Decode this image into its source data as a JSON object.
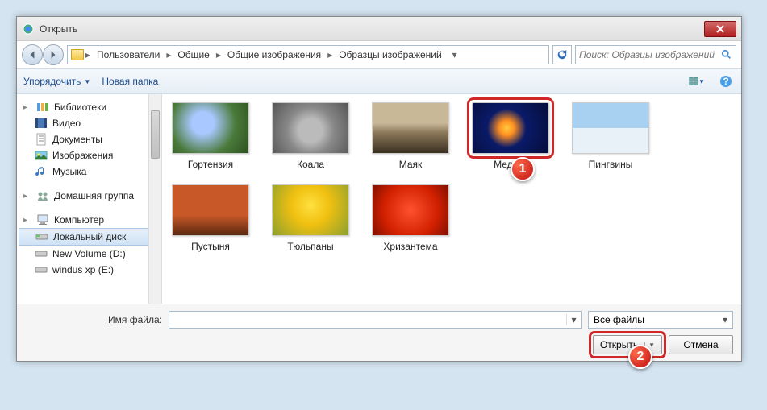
{
  "title": "Открыть",
  "breadcrumb": [
    "Пользователи",
    "Общие",
    "Общие изображения",
    "Образцы изображений"
  ],
  "search_placeholder": "Поиск: Образцы изображений",
  "toolbar": {
    "organize": "Упорядочить",
    "newfolder": "Новая папка"
  },
  "sidebar": {
    "libraries": {
      "label": "Библиотеки",
      "items": [
        "Видео",
        "Документы",
        "Изображения",
        "Музыка"
      ]
    },
    "homegroup": "Домашняя группа",
    "computer": {
      "label": "Компьютер",
      "drives": [
        "Локальный диск",
        "New Volume (D:)",
        "windus xp (E:)"
      ]
    }
  },
  "files": [
    {
      "name": "Гортензия",
      "class": "g-flower1"
    },
    {
      "name": "Коала",
      "class": "g-koala"
    },
    {
      "name": "Маяк",
      "class": "g-light"
    },
    {
      "name": "Медуза",
      "class": "g-jelly",
      "selected": true
    },
    {
      "name": "Пингвины",
      "class": "g-peng"
    },
    {
      "name": "Пустыня",
      "class": "g-desert"
    },
    {
      "name": "Тюльпаны",
      "class": "g-tulip"
    },
    {
      "name": "Хризантема",
      "class": "g-chrys"
    }
  ],
  "bottom": {
    "filename_label": "Имя файла:",
    "filename_value": "",
    "filter": "Все файлы",
    "open": "Открыть",
    "cancel": "Отмена"
  },
  "callouts": {
    "one": "1",
    "two": "2"
  }
}
